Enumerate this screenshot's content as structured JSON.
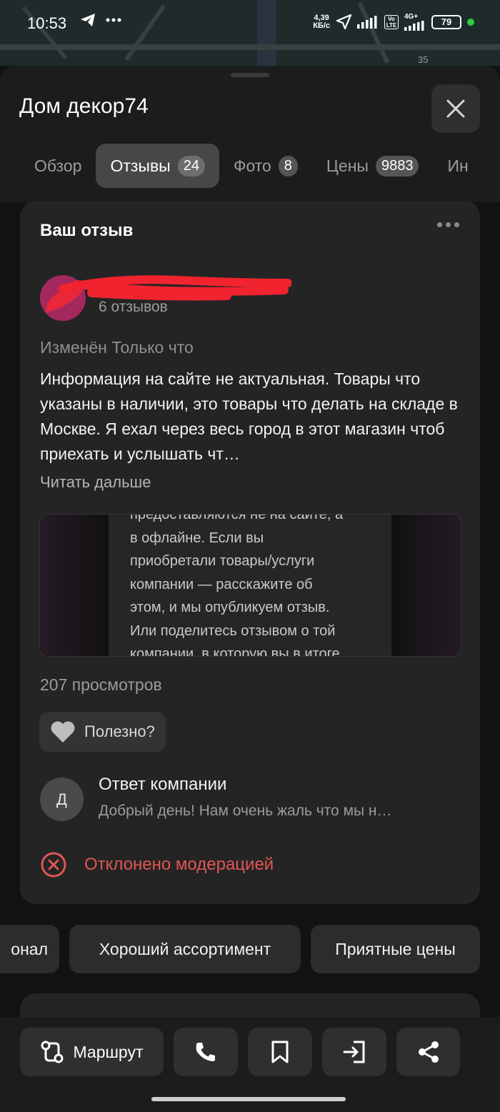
{
  "status_bar": {
    "time": "10:53",
    "net_speed_value": "4,39",
    "net_speed_unit": "КБ/с",
    "network_label": "4G+",
    "volte_label": "Vo LTE",
    "battery": "79",
    "map_number": "35"
  },
  "header": {
    "title": "Дом декор74",
    "tabs": [
      {
        "label": "Обзор",
        "count": ""
      },
      {
        "label": "Отзывы",
        "count": "24"
      },
      {
        "label": "Фото",
        "count": "8"
      },
      {
        "label": "Цены",
        "count": "9883"
      },
      {
        "label": "Ин",
        "count": ""
      }
    ]
  },
  "review": {
    "card_title": "Ваш отзыв",
    "author_reviews": "6 отзывов",
    "edited": "Изменён Только что",
    "text": "Информация на сайте не актуальная. Товары что указаны в наличии, это товары что делать на складе в Москве. Я ехал через весь город в этот магазин чтоб приехать и услышать чт…",
    "read_more": "Читать дальше",
    "photo_lines": [
      "предоставляются не на сайте, а",
      "в офлайне. Если вы",
      "приобретали товары/услуги",
      "компании — расскажите об",
      "этом, и мы опубликуем отзыв.",
      "Или поделитесь отзывом о той",
      "компании, в которую вы в итоге"
    ],
    "views": "207 просмотров",
    "useful_label": "Полезно?",
    "reply_avatar_letter": "Д",
    "reply_title": "Ответ компании",
    "reply_text": "Добрый день! Нам очень жаль что мы н…",
    "status": "Отклонено модерацией"
  },
  "chips": [
    "онал",
    "Хороший ассортимент",
    "Приятные цены"
  ],
  "bottom_bar": {
    "route_label": "Маршрут"
  },
  "colors": {
    "accent_red": "#e25555",
    "sheet_bg": "#1c1c1c",
    "card_bg": "#242424"
  }
}
